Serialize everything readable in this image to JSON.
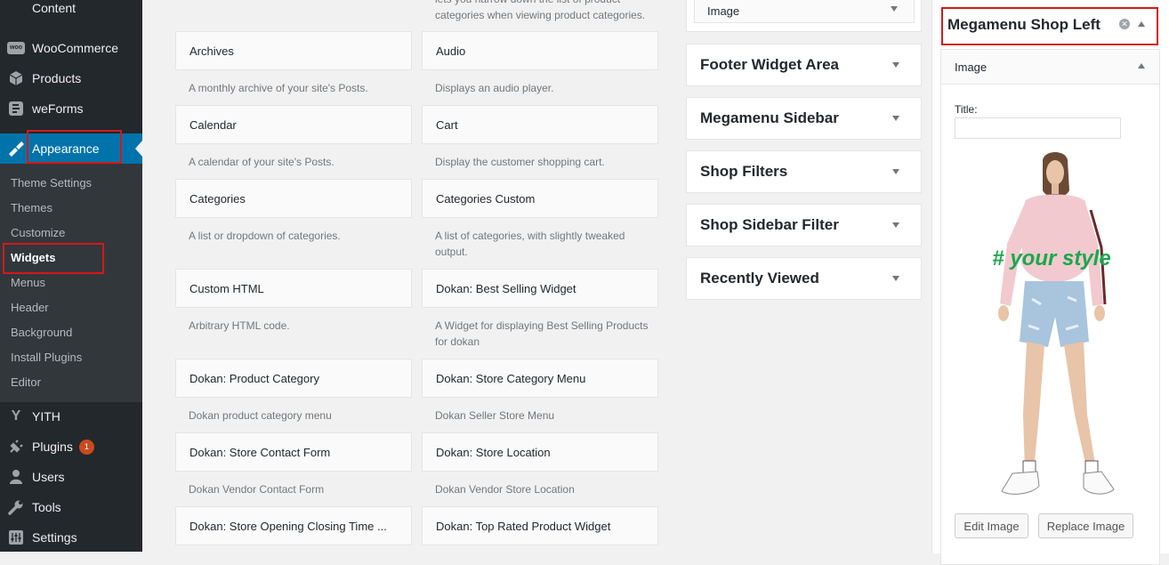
{
  "sidebar": {
    "content_label": "Content",
    "woocommerce_label": "WooCommerce",
    "products_label": "Products",
    "weforms_label": "weForms",
    "appearance_label": "Appearance",
    "submenu": [
      "Theme Settings",
      "Themes",
      "Customize",
      "Widgets",
      "Menus",
      "Header",
      "Background",
      "Install Plugins",
      "Editor"
    ],
    "yith_label": "YITH",
    "plugins_label": "Plugins",
    "plugins_badge": "1",
    "users_label": "Users",
    "tools_label": "Tools",
    "settings_label": "Settings",
    "woo_icon_text": "woo"
  },
  "available_widgets": {
    "top_desc_partial": "lets you narrow down the list of product categories when viewing product categories.",
    "items": [
      {
        "name": "Archives",
        "desc": "A monthly archive of your site's Posts."
      },
      {
        "name": "Audio",
        "desc": "Displays an audio player."
      },
      {
        "name": "Calendar",
        "desc": "A calendar of your site's Posts."
      },
      {
        "name": "Cart",
        "desc": "Display the customer shopping cart."
      },
      {
        "name": "Categories",
        "desc": "A list or dropdown of categories."
      },
      {
        "name": "Categories Custom",
        "desc": "A list of categories, with slightly tweaked output."
      },
      {
        "name": "Custom HTML",
        "desc": "Arbitrary HTML code."
      },
      {
        "name": "Dokan: Best Selling Widget",
        "desc": "A Widget for displaying Best Selling Products for dokan"
      },
      {
        "name": "Dokan: Product Category",
        "desc": "Dokan product category menu"
      },
      {
        "name": "Dokan: Store Category Menu",
        "desc": "Dokan Seller Store Menu"
      },
      {
        "name": "Dokan: Store Contact Form",
        "desc": "Dokan Vendor Contact Form"
      },
      {
        "name": "Dokan: Store Location",
        "desc": "Dokan Vendor Store Location"
      },
      {
        "name": "Dokan: Store Opening Closing Time ...",
        "desc": ""
      },
      {
        "name": "Dokan: Top Rated Product Widget",
        "desc": ""
      }
    ]
  },
  "widget_areas": {
    "image_widget_label": "Image",
    "areas": [
      "Footer Widget Area",
      "Megamenu Sidebar",
      "Shop Filters",
      "Shop Sidebar Filter",
      "Recently Viewed"
    ]
  },
  "megamenu_panel": {
    "title": "Megamenu Shop Left",
    "widget_label": "Image",
    "title_field_label": "Title:",
    "title_field_value": "",
    "image_overlay_text": "# your style",
    "edit_button": "Edit Image",
    "replace_button": "Replace Image"
  },
  "colors": {
    "sidebar_bg": "#23282d",
    "submenu_bg": "#32373c",
    "active_blue": "#0073aa",
    "highlight_red": "#d21a1a",
    "overlay_green": "#1aa84a",
    "badge": "#ca4a1f"
  }
}
